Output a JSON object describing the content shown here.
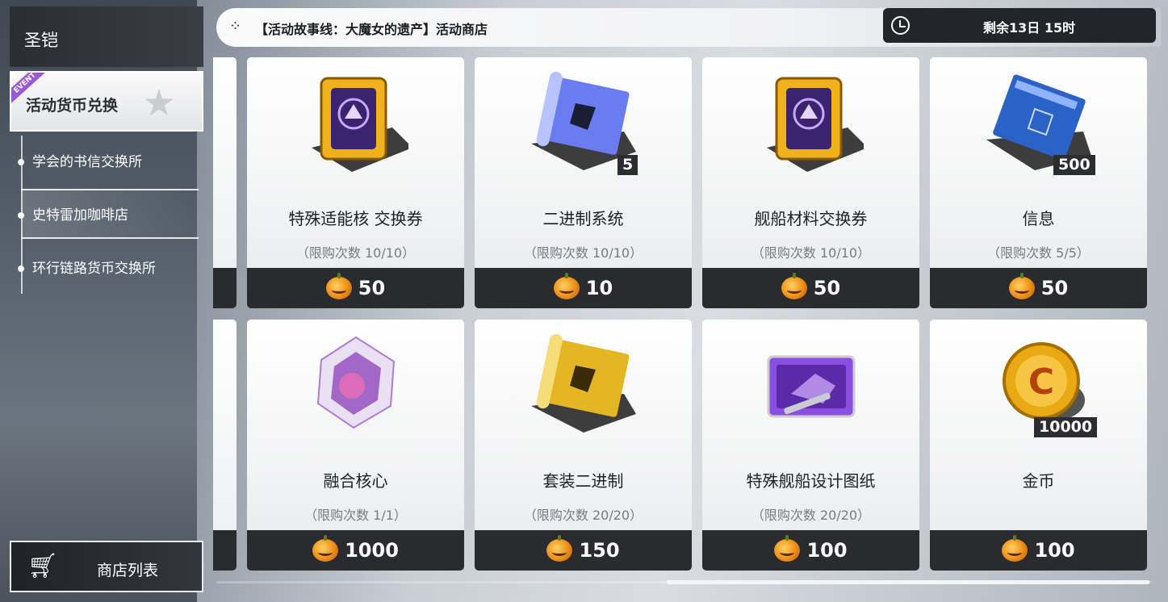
{
  "sidebar": {
    "brand": "圣铠",
    "category": {
      "label": "活动货币兑换",
      "tag": "EVENT"
    },
    "subitems": [
      {
        "label": "学会的书信交换所"
      },
      {
        "label": "史特雷加咖啡店"
      },
      {
        "label": "环行链路货币交换所"
      }
    ],
    "shop_list_label": "商店列表"
  },
  "header": {
    "title": "【活动故事线：大魔女的遗产】活动商店",
    "remaining": "剩余13日 15时"
  },
  "items": [
    {
      "name": "特殊适能核 交换券",
      "limit": "（限购次数 10/10）",
      "price": "50",
      "qty": "",
      "icon": "misc-ticket-gold",
      "accent": "#f0b21c"
    },
    {
      "name": "二进制系统",
      "limit": "（限购次数 10/10）",
      "price": "10",
      "qty": "5",
      "icon": "tuning-blueprint",
      "accent": "#6b7cf0"
    },
    {
      "name": "舰船材料交换券",
      "limit": "（限购次数 10/10）",
      "price": "50",
      "qty": "",
      "icon": "misc-ticket-gold",
      "accent": "#f0b21c"
    },
    {
      "name": "信息",
      "limit": "（限购次数 5/5）",
      "price": "50",
      "qty": "500",
      "icon": "information-book",
      "accent": "#2a62c8"
    },
    {
      "name": "融合核心",
      "limit": "（限购次数 1/1）",
      "price": "1000",
      "qty": "",
      "icon": "fusion-crystal",
      "accent": "#b27ad8"
    },
    {
      "name": "套装二进制",
      "limit": "（限购次数 20/20）",
      "price": "150",
      "qty": "",
      "icon": "gold-blueprint",
      "accent": "#e5b624"
    },
    {
      "name": "特殊舰船设计图纸",
      "limit": "（限购次数 20/20）",
      "price": "100",
      "qty": "",
      "icon": "lost-ship-card",
      "accent": "#8a4fe0"
    },
    {
      "name": "金币",
      "limit": "",
      "price": "100",
      "qty": "10000",
      "icon": "gold-coin",
      "accent": "#e8a912"
    }
  ],
  "currency_icon": "pumpkin-icon",
  "scroll_position": 0.58
}
